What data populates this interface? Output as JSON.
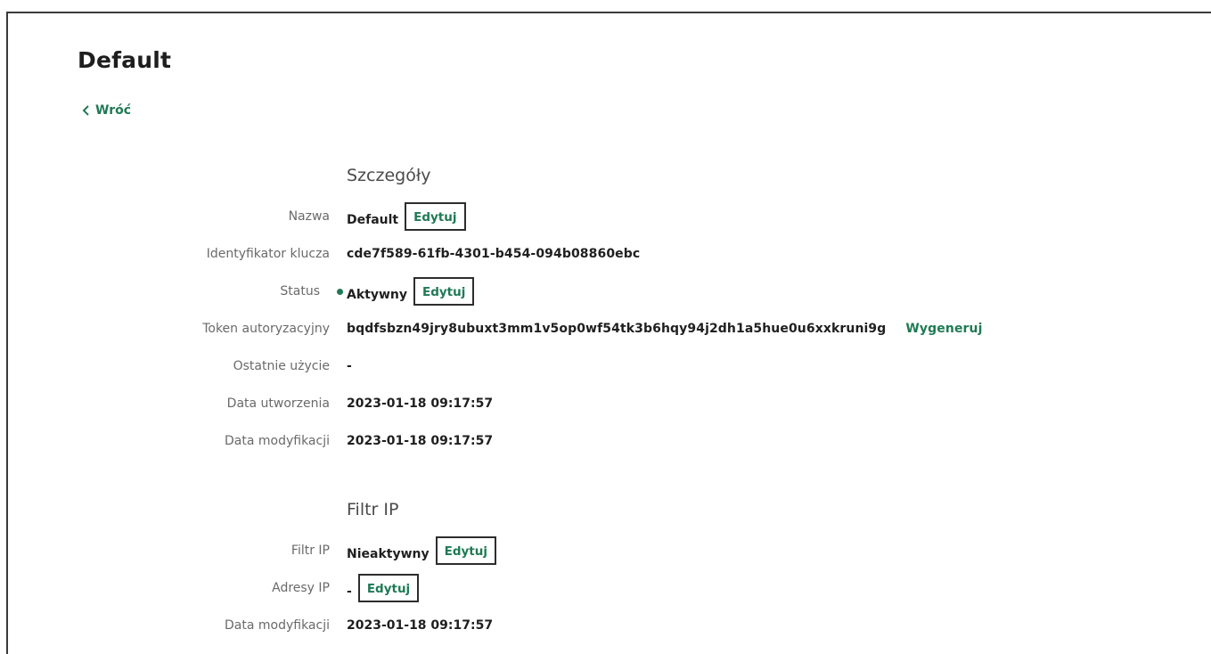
{
  "page": {
    "title": "Default",
    "back_label": "Wróć"
  },
  "details": {
    "section_title": "Szczegóły",
    "name_label": "Nazwa",
    "name_value": "Default",
    "name_edit": "Edytuj",
    "key_id_label": "Identyfikator klucza",
    "key_id_value": "cde7f589-61fb-4301-b454-094b08860ebc",
    "status_label": "Status",
    "status_value": "Aktywny",
    "status_edit": "Edytuj",
    "token_label": "Token autoryzacyjny",
    "token_value": "bqdfsbzn49jry8ubuxt3mm1v5op0wf54tk3b6hqy94j2dh1a5hue0u6xxkruni9g",
    "token_regen": "Wygeneruj",
    "last_used_label": "Ostatnie użycie",
    "last_used_value": "-",
    "created_label": "Data utworzenia",
    "created_value": "2023-01-18 09:17:57",
    "modified_label": "Data modyfikacji",
    "modified_value": "2023-01-18 09:17:57"
  },
  "ip_filter": {
    "section_title": "Filtr IP",
    "filter_label": "Filtr IP",
    "filter_value": "Nieaktywny",
    "filter_edit": "Edytuj",
    "addresses_label": "Adresy IP",
    "addresses_value": "-",
    "addresses_edit": "Edytuj",
    "modified_label": "Data modyfikacji",
    "modified_value": "2023-01-18 09:17:57"
  },
  "colors": {
    "accent": "#1f7a55",
    "status_active": "#1f7a55"
  },
  "icons": {
    "back": "chevron-left-icon",
    "status": "status-dot-icon"
  }
}
